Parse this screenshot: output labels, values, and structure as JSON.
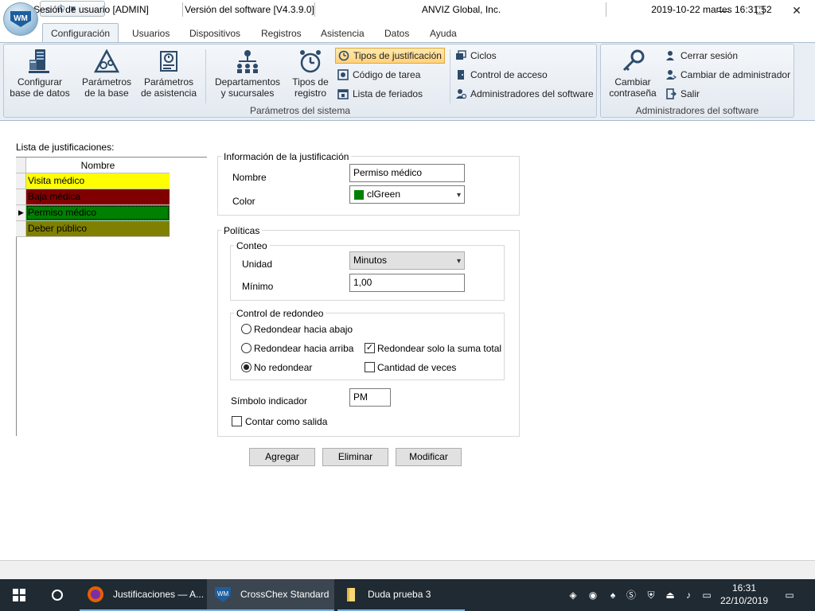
{
  "window": {
    "minimize": "—",
    "maximize": "☐",
    "close": "✕"
  },
  "tabs": [
    "Configuración",
    "Usuarios",
    "Dispositivos",
    "Registros",
    "Asistencia",
    "Datos",
    "Ayuda"
  ],
  "ribbon": {
    "system_group_label": "Parámetros del sistema",
    "software_group_label": "Administradores del software",
    "big_buttons": [
      {
        "line1": "Configurar",
        "line2": "base de datos"
      },
      {
        "line1": "Parámetros",
        "line2": "de la base"
      },
      {
        "line1": "Parámetros",
        "line2": "de asistencia"
      },
      {
        "line1": "Departamentos",
        "line2": "y sucursales"
      },
      {
        "line1": "Tipos de",
        "line2": "registro"
      },
      {
        "line1": "Cambiar",
        "line2": "contraseña"
      }
    ],
    "small_buttons": [
      "Tipos de justificación",
      "Código de tarea",
      "Lista de feriados",
      "Ciclos",
      "Control de acceso",
      "Administradores del software",
      "Cerrar sesión",
      "Cambiar de administrador",
      "Salir"
    ]
  },
  "list": {
    "title": "Lista de justificaciones:",
    "header": "Nombre",
    "rows": [
      {
        "name": "Visita médico",
        "color": "#ffff00"
      },
      {
        "name": "Baja médica",
        "color": "#800000"
      },
      {
        "name": "Permiso médico",
        "color": "#008000",
        "selected": true
      },
      {
        "name": "Deber público",
        "color": "#808000"
      }
    ]
  },
  "info": {
    "title": "Información de la justificación",
    "name_label": "Nombre",
    "name_value": "Permiso médico",
    "color_label": "Color",
    "color_value": "clGreen",
    "color_swatch": "#008000"
  },
  "policies": {
    "title": "Políticas",
    "count_title": "Conteo",
    "unit_label": "Unidad",
    "unit_value": "Minutos",
    "min_label": "Mínimo",
    "min_value": "1,00",
    "round_title": "Control de redondeo",
    "round_down": "Redondear hacia abajo",
    "round_up": "Redondear hacia arriba",
    "no_round": "No redondear",
    "round_sum": "Redondear solo la suma total",
    "times": "Cantidad de veces",
    "symbol_label": "Símbolo indicador",
    "symbol_value": "PM",
    "count_exit": "Contar como salida"
  },
  "actions": {
    "add": "Agregar",
    "delete": "Eliminar",
    "modify": "Modificar"
  },
  "status": {
    "session": "Sesión de usuario  [ADMIN]",
    "version": "Versión del software  [V4.3.9.0]",
    "company": "ANVIZ Global, Inc.",
    "datetime": "2019-10-22 martes 16:31:52"
  },
  "taskbar": {
    "items": [
      "Justificaciones — A...",
      "CrossChex Standard",
      "Duda prueba 3"
    ],
    "time": "16:31",
    "date": "22/10/2019"
  },
  "colors": {
    "accent": "#1e5e9c",
    "highlight": "#ffd27a",
    "taskbar": "#1f2a33"
  }
}
